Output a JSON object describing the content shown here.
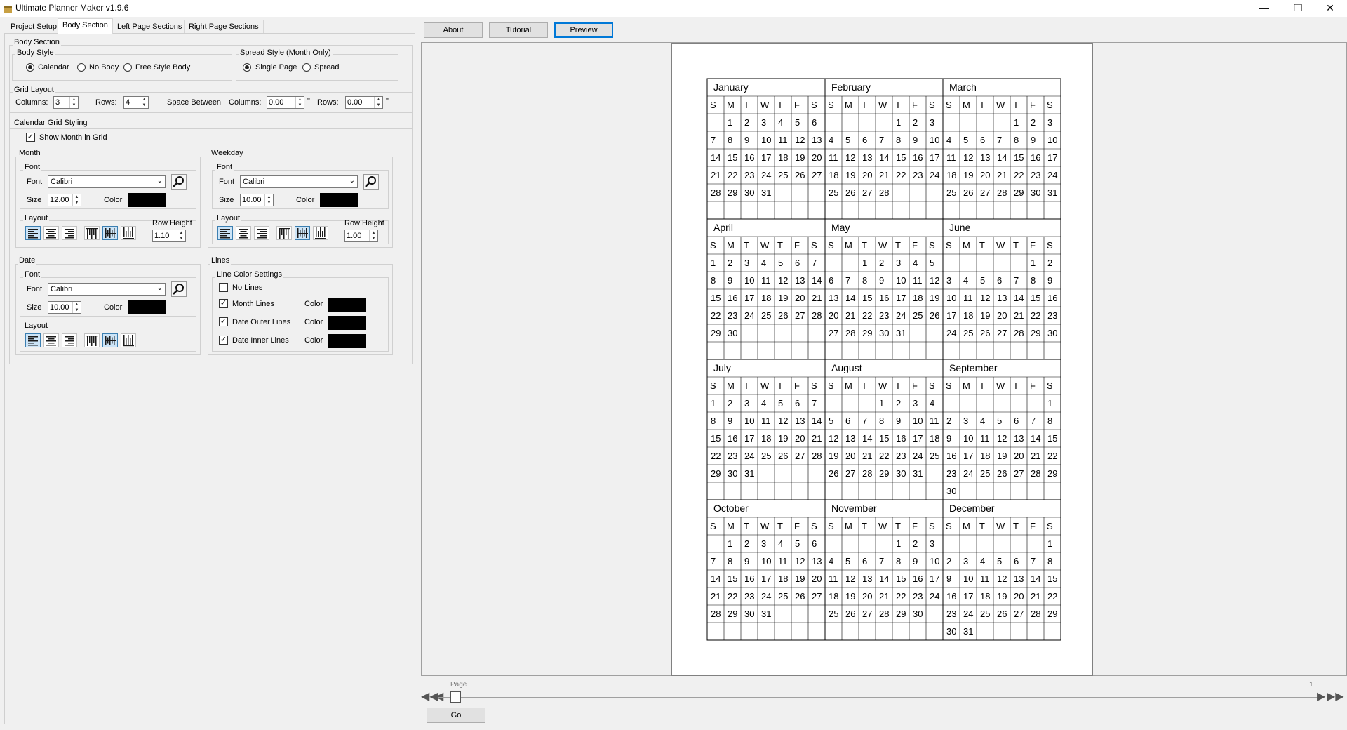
{
  "window": {
    "title": "Ultimate Planner Maker v1.9.6",
    "min": "—",
    "max": "❐",
    "close": "✕"
  },
  "tabs": [
    "Project Setup",
    "Body Section",
    "Left Page Sections",
    "Right Page Sections"
  ],
  "body_section": {
    "title": "Body Section",
    "body_style": {
      "label": "Body Style",
      "options": [
        "Calendar",
        "No Body",
        "Free Style Body"
      ],
      "selected": "Calendar"
    },
    "spread_style": {
      "label": "Spread Style (Month Only)",
      "options": [
        "Single Page",
        "Spread"
      ],
      "selected": "Single Page"
    },
    "grid_layout": {
      "label": "Grid Layout",
      "columns_label": "Columns:",
      "columns": "3",
      "rows_label": "Rows:",
      "rows": "4",
      "space_between": "Space Between",
      "sb_columns_label": "Columns:",
      "sb_columns": "0.00",
      "sb_columns_unit": "\"",
      "sb_rows_label": "Rows:",
      "sb_rows": "0.00",
      "sb_rows_unit": "\""
    },
    "calendar_grid_styling": {
      "label": "Calendar Grid Styling",
      "show_month": "Show Month in Grid",
      "month": {
        "label": "Month",
        "font_group": "Font",
        "font_label": "Font",
        "font": "Calibri",
        "size_label": "Size",
        "size": "12.00",
        "color_label": "Color",
        "layout_label": "Layout",
        "row_height_label": "Row Height",
        "row_height": "1.10"
      },
      "weekday": {
        "label": "Weekday",
        "font_group": "Font",
        "font_label": "Font",
        "font": "Calibri",
        "size_label": "Size",
        "size": "10.00",
        "color_label": "Color",
        "layout_label": "Layout",
        "row_height_label": "Row Height",
        "row_height": "1.00"
      },
      "date": {
        "label": "Date",
        "font_group": "Font",
        "font_label": "Font",
        "font": "Calibri",
        "size_label": "Size",
        "size": "10.00",
        "color_label": "Color",
        "layout_label": "Layout"
      },
      "lines": {
        "label": "Lines",
        "group": "Line Color Settings",
        "no_lines": "No Lines",
        "month_lines": "Month Lines",
        "date_outer": "Date Outer Lines",
        "date_inner": "Date Inner Lines",
        "color_label": "Color"
      }
    }
  },
  "toolbar": {
    "about": "About",
    "tutorial": "Tutorial",
    "preview": "Preview"
  },
  "pager": {
    "page_label": "Page",
    "page_number": "1",
    "go": "Go"
  },
  "calendar": {
    "weekdays": [
      "S",
      "M",
      "T",
      "W",
      "T",
      "F",
      "S"
    ],
    "months": [
      {
        "name": "January",
        "start": 1,
        "days": 31
      },
      {
        "name": "February",
        "start": 4,
        "days": 28
      },
      {
        "name": "March",
        "start": 4,
        "days": 31
      },
      {
        "name": "April",
        "start": 0,
        "days": 30
      },
      {
        "name": "May",
        "start": 2,
        "days": 31
      },
      {
        "name": "June",
        "start": 5,
        "days": 30
      },
      {
        "name": "July",
        "start": 0,
        "days": 31
      },
      {
        "name": "August",
        "start": 3,
        "days": 31
      },
      {
        "name": "September",
        "start": 6,
        "days": 30
      },
      {
        "name": "October",
        "start": 1,
        "days": 31
      },
      {
        "name": "November",
        "start": 4,
        "days": 30
      },
      {
        "name": "December",
        "start": 6,
        "days": 31
      }
    ]
  }
}
